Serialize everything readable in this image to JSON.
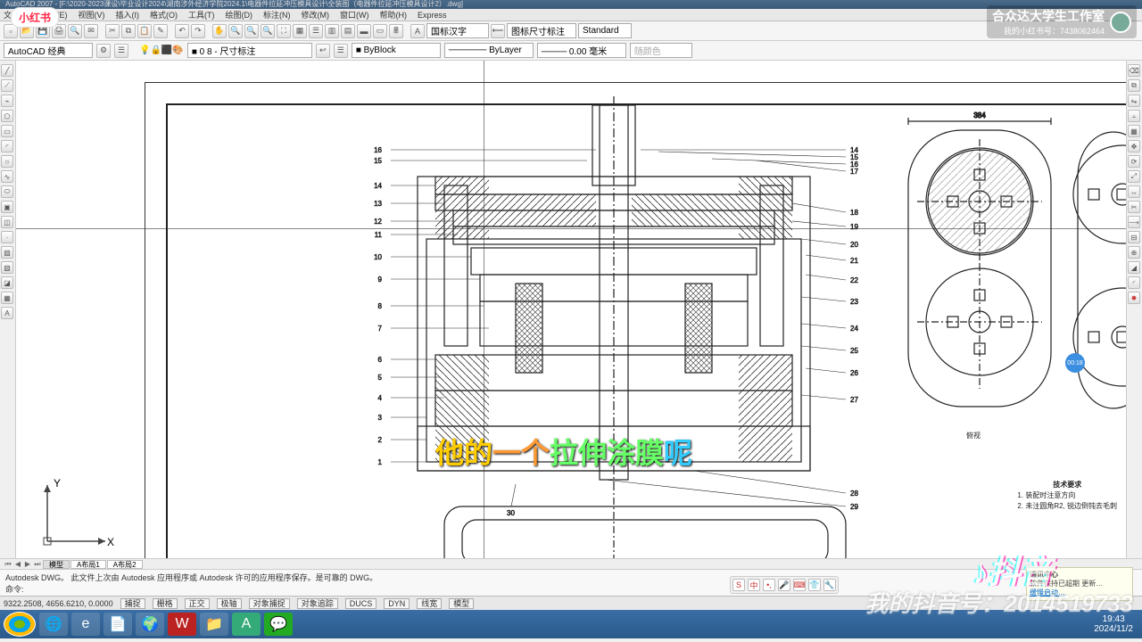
{
  "app": {
    "title_path": "AutoCAD 2007 - [F:\\2020-2023课设\\毕业设计2024\\湖南涉外经济学院2024.1\\电器件拉延冲压模具设计\\全装图（电器件拉延冲压模具设计2）.dwg]"
  },
  "menus": [
    "文件(F)",
    "编辑(E)",
    "视图(V)",
    "插入(I)",
    "格式(O)",
    "工具(T)",
    "绘图(D)",
    "标注(N)",
    "修改(M)",
    "窗口(W)",
    "帮助(H)",
    "Express"
  ],
  "toolbar1": {
    "text_style": "国标汉字",
    "dim_style": "图标尺寸标注",
    "table_style": "Standard"
  },
  "toolbar2": {
    "workspace": "AutoCAD 经典",
    "layer": "■ 0 8 - 尺寸标注",
    "color": "■ ByBlock",
    "linetype": "────── ByLayer",
    "lineweight": "──── 0.00 毫米",
    "plotstyle": "随颜色"
  },
  "ucs": {
    "y": "Y",
    "x": "X"
  },
  "subtitle": {
    "part1": "他的",
    "part2": "一个",
    "part3": "拉伸涂膜",
    "part4": "呢"
  },
  "watermark": {
    "studio": "合众达大学生工作室",
    "xhs_id": "我的小红书号：7438062464",
    "douyin_id": "我的抖音号：2014519733",
    "douyin_text": "抖音",
    "xhs_badge": "小红书",
    "timer": "00:18"
  },
  "drawing": {
    "leaders_left": [
      "16",
      "15",
      "14",
      "13",
      "12",
      "11",
      "10",
      "9",
      "8",
      "7",
      "6",
      "5",
      "4",
      "3",
      "2",
      "1"
    ],
    "leaders_right": [
      "14",
      "15",
      "16",
      "17",
      "18",
      "19",
      "20",
      "21",
      "22",
      "23",
      "24",
      "25",
      "26",
      "27",
      "28",
      "29",
      "30"
    ],
    "dim_top_plan": "384",
    "tech_req_title": "技术要求",
    "tech_req_lines": [
      "1. 装配时注意方向",
      "2. 未注圆角R2, 锐边倒钝去毛刺"
    ],
    "plan_label": "俯视"
  },
  "tabs": {
    "nav": [
      "⏮",
      "◀",
      "▶",
      "⏭"
    ],
    "items": [
      "模型",
      "A布局1",
      "A布局2"
    ]
  },
  "command": {
    "line1": "Autodesk DWG。  此文件上次由 Autodesk 应用程序或 Autodesk 许可的应用程序保存。是可靠的 DWG。",
    "line2": "命令:"
  },
  "status": {
    "coords": "9322.2508, 4656.6210, 0.0000",
    "buttons": [
      "捕捉",
      "栅格",
      "正交",
      "极轴",
      "对象捕捉",
      "对象追踪",
      "DUCS",
      "DYN",
      "线宽",
      "模型"
    ]
  },
  "notice": {
    "title": "通讯中心",
    "line1": "软件保持已超期 更新…",
    "line2": "缓慢启动…"
  },
  "taskbar": {
    "time": "19:43",
    "date": "2024/11/2"
  }
}
